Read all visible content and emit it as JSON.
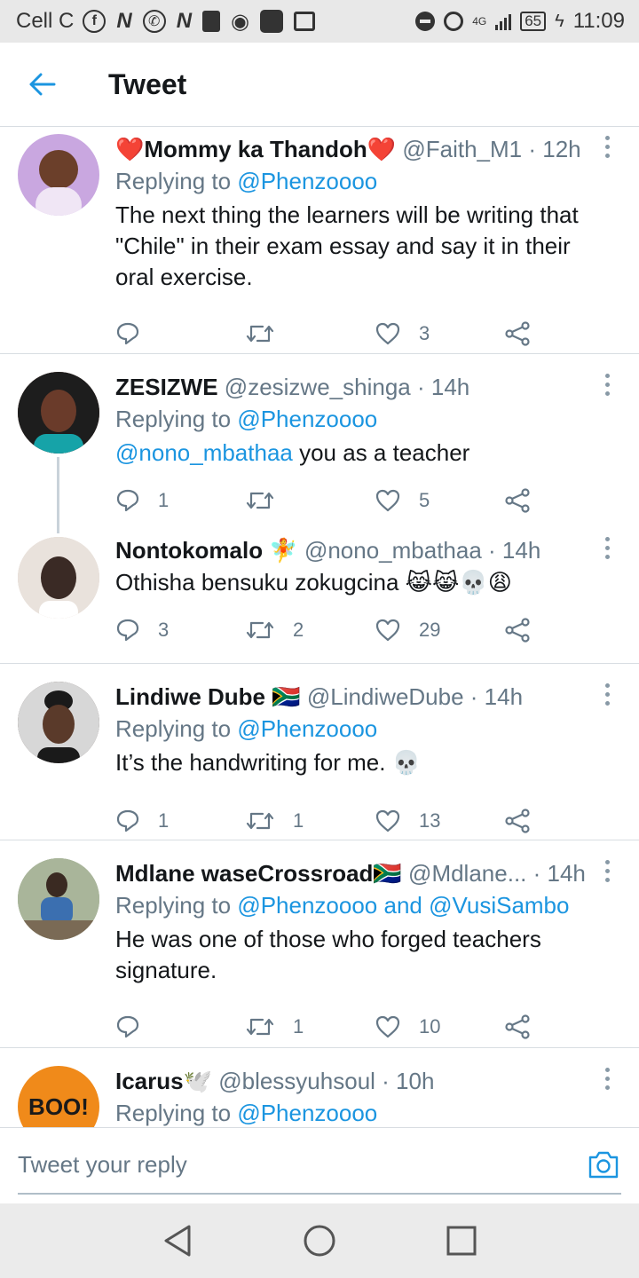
{
  "status_bar": {
    "carrier": "Cell C",
    "network": "4G",
    "battery": "65",
    "time": "11:09",
    "left_icons": [
      "facebook-icon",
      "n-icon",
      "whatsapp-icon",
      "n-icon",
      "sdcard-icon",
      "record-icon",
      "app-icon",
      "image-icon"
    ]
  },
  "header": {
    "title": "Tweet"
  },
  "tweets": [
    {
      "name": "❤️Mommy ka Thandoh❤️",
      "handle": "@Faith_M1",
      "time": "· 12h",
      "reply_prefix": "Replying to ",
      "reply_to": "@Phenzoooo",
      "text": "The next thing the learners will be writing that \"Chile\" in their exam essay and say it in their oral exercise.",
      "replies": "",
      "retweets": "",
      "likes": "3",
      "avatar_color": "#c9a7e0"
    },
    {
      "name": "ZESIZWE",
      "handle": "@zesizwe_shinga",
      "time": "· 14h",
      "reply_prefix": "Replying to ",
      "reply_to": "@Phenzoooo",
      "mention": "@nono_mbathaa",
      "text": " you as a teacher",
      "replies": "1",
      "retweets": "",
      "likes": "5",
      "avatar_color": "#6a3b2a"
    },
    {
      "name": "Nontokomalo 🧚",
      "handle": "@nono_mbathaa",
      "time": "· 14h",
      "text": "Othisha bensuku zokugcina 😹😹💀😩",
      "replies": "3",
      "retweets": "2",
      "likes": "29",
      "avatar_color": "#d8c4b8"
    },
    {
      "name": "Lindiwe Dube 🇿🇦",
      "handle": "@LindiweDube",
      "time": "· 14h",
      "reply_prefix": "Replying to ",
      "reply_to": "@Phenzoooo",
      "text": "It’s the handwriting for me. 💀",
      "replies": "1",
      "retweets": "1",
      "likes": "13",
      "avatar_color": "#4a3a35"
    },
    {
      "name": "Mdlane waseCrossroad🇿🇦",
      "handle": "@Mdlane...",
      "time": "· 14h",
      "reply_prefix": "Replying to ",
      "reply_to": "@Phenzoooo and @VusiSambo",
      "text": "He was one of those who forged teachers signature.",
      "replies": "",
      "retweets": "1",
      "likes": "10",
      "avatar_color": "#8a9a7a"
    },
    {
      "name": "Icarus🕊️",
      "handle": "@blessyuhsoul",
      "time": "· 10h",
      "reply_prefix": "Replying to ",
      "reply_to": "@Phenzoooo",
      "avatar_color": "#f08a1a",
      "avatar_text": "BOO!"
    }
  ],
  "reply_bar": {
    "placeholder": "Tweet your reply"
  },
  "colors": {
    "link": "#1b95e0",
    "muted": "#657786",
    "text": "#14171a"
  }
}
